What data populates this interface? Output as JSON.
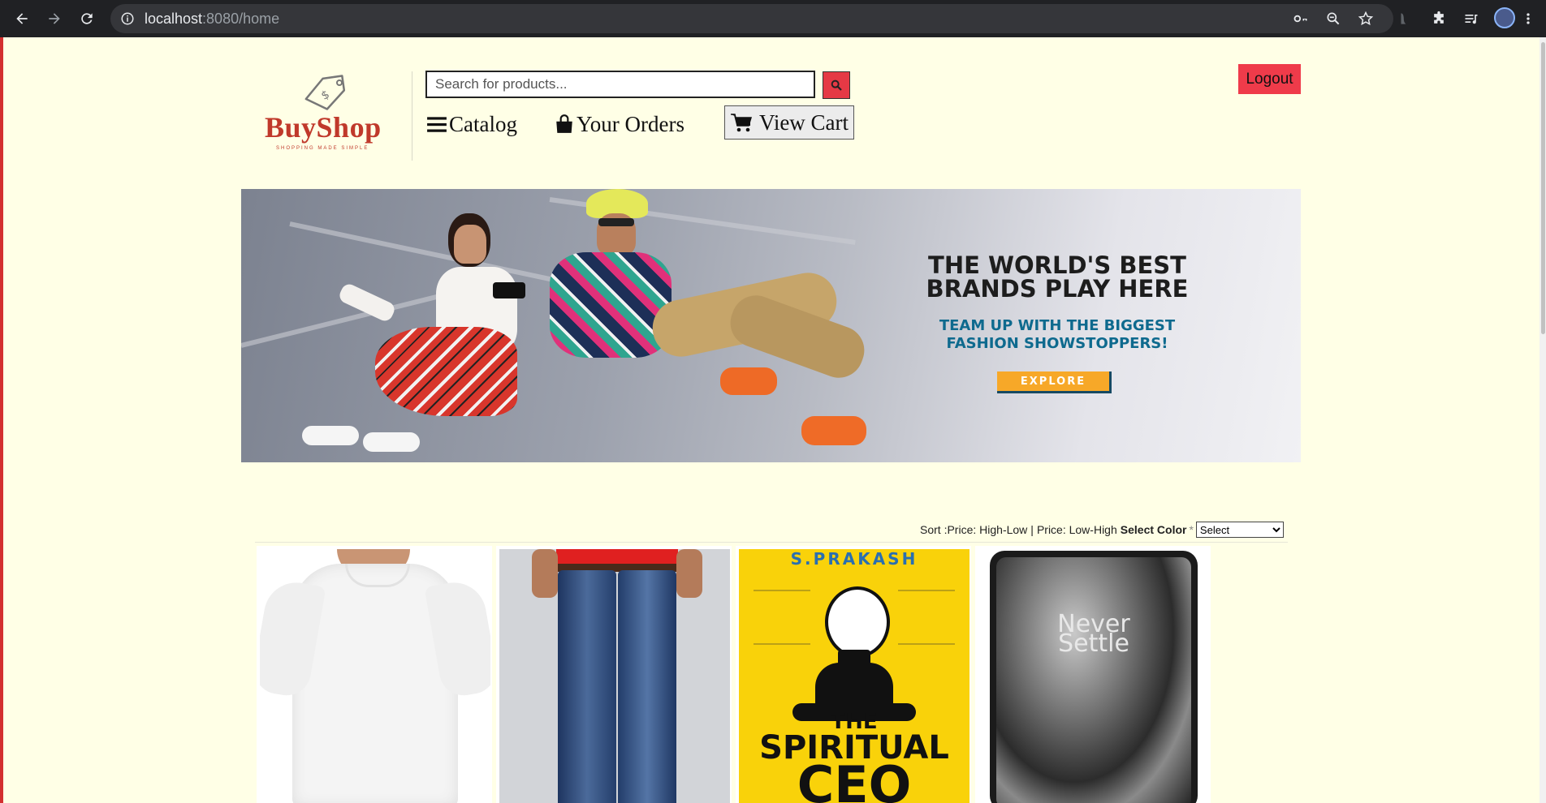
{
  "browser": {
    "url_host": "localhost",
    "url_rest": ":8080/home",
    "icons": [
      "back-icon",
      "forward-icon",
      "reload-icon",
      "info-icon",
      "key-icon",
      "zoom-icon",
      "star-icon",
      "extensions-icon",
      "media-icon",
      "menu-icon"
    ]
  },
  "brand": {
    "name": "BuyShop",
    "tagline": "SHOPPING MADE SIMPLE",
    "color": "#c0392b"
  },
  "search": {
    "placeholder": "Search for products...",
    "value": ""
  },
  "nav": {
    "catalog": "Catalog",
    "orders": "Your Orders",
    "cart": "View Cart",
    "logout": "Logout"
  },
  "hero": {
    "title": "THE WORLD'S BEST BRANDS PLAY HERE",
    "subtitle": "TEAM UP WITH THE BIGGEST FASHION SHOWSTOPPERS!",
    "cta": "EXPLORE"
  },
  "sort": {
    "label": "Sort : ",
    "high_low": "Price: High-Low",
    "separator": "|",
    "low_high": "Price: Low-High",
    "color_label": "Select Color",
    "required_mark": "*",
    "color_selected": "Select"
  },
  "products": [
    {
      "image": "white-tshirt"
    },
    {
      "image": "blue-jeans"
    },
    {
      "image": "book-spiritual-ceo",
      "author": "S.PRAKASH",
      "title_line1": "THE",
      "title_line2": "SPIRITUAL",
      "title_line3": "CEO"
    },
    {
      "image": "phone-never-settle",
      "screen_text_1": "Never",
      "screen_text_2": "Settle"
    }
  ],
  "colors": {
    "accent": "#e53945",
    "page_bg": "#ffffe6",
    "chrome": "#202124"
  }
}
